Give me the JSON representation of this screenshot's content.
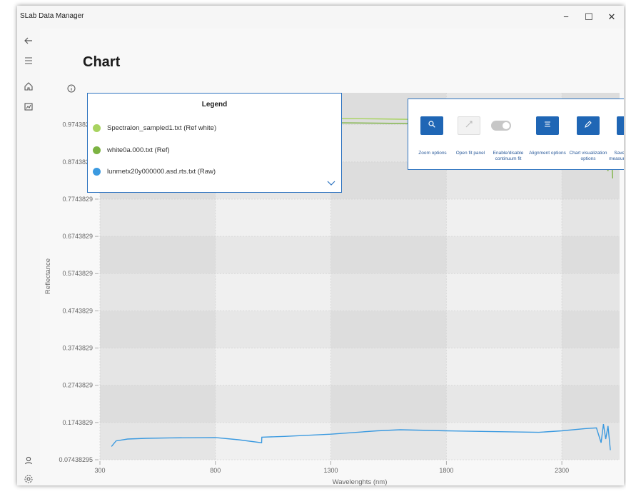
{
  "window": {
    "title": "SLab Data Manager",
    "controls": {
      "minimize": "−",
      "maximize": "☐",
      "close": "✕"
    }
  },
  "rail": {
    "top_icons": [
      "back-arrow-icon",
      "hamburger-menu-icon",
      "home-icon",
      "chart-icon"
    ],
    "bottom_icons": [
      "user-icon",
      "settings-gear-icon"
    ]
  },
  "page": {
    "title": "Chart"
  },
  "legend": {
    "title": "Legend",
    "items": [
      {
        "label": "Spectralon_sampled1.txt (Ref white)",
        "color": "#a8d360"
      },
      {
        "label": "white0a.000.txt (Ref)",
        "color": "#7cb342"
      },
      {
        "label": "lunmetx20y000000.asd.rts.txt (Raw)",
        "color": "#3b9ae0"
      }
    ]
  },
  "toolbar": {
    "zoom_label": "Zoom options",
    "open_fit_label": "Open fit panel",
    "continuum_label": "Enable/disable continuum fit",
    "alignment_label": "Alignment options",
    "chart_vis_label": "Chart visualization options",
    "save_label": "Save sample/ measurement/ info"
  },
  "chart_data": {
    "type": "line",
    "xlabel": "Wavelenghts (nm)",
    "ylabel": "Reflectance",
    "xlim": [
      300,
      2550
    ],
    "ylim": [
      0.07438295,
      1.06
    ],
    "x_ticks": [
      "300",
      "800",
      "1300",
      "1800",
      "2300"
    ],
    "y_ticks": [
      "0.07438295",
      "0.1743829",
      "0.2743829",
      "0.3743829",
      "0.4743829",
      "0.5743829",
      "0.6743829",
      "0.7743829",
      "0.8743829",
      "0.9743829"
    ],
    "grid": true,
    "series": [
      {
        "name": "Spectralon_sampled1.txt (Ref white)",
        "color": "#a8d360",
        "x": [
          300,
          350,
          400,
          500,
          700,
          900,
          1100,
          1300,
          1500,
          1700,
          1800,
          1900,
          2000,
          2100,
          2200,
          2250,
          2300,
          2400,
          2450,
          2480,
          2500
        ],
        "y": [
          0.985,
          0.995,
          0.998,
          0.998,
          0.996,
          0.994,
          0.992,
          0.991,
          0.99,
          0.988,
          0.987,
          0.983,
          0.978,
          0.968,
          0.962,
          0.955,
          0.958,
          0.955,
          0.952,
          0.95,
          0.948
        ]
      },
      {
        "name": "white0a.000.txt (Ref)",
        "color": "#7cb342",
        "x": [
          350,
          380,
          450,
          600,
          800,
          1000,
          1200,
          1400,
          1600,
          1800,
          1950,
          2050,
          2100,
          2130,
          2180,
          2220,
          2300,
          2400,
          2450,
          2480,
          2500,
          2510,
          2520
        ],
        "y": [
          0.965,
          0.985,
          0.985,
          0.985,
          0.984,
          0.982,
          0.98,
          0.979,
          0.978,
          0.976,
          0.97,
          0.955,
          0.935,
          0.93,
          0.95,
          0.95,
          0.93,
          0.92,
          0.905,
          0.9,
          0.85,
          0.96,
          0.83
        ]
      },
      {
        "name": "lunmetx20y000000.asd.rts.txt (Raw)",
        "color": "#3b9ae0",
        "x": [
          350,
          370,
          420,
          500,
          600,
          800,
          900,
          1000,
          1001,
          1100,
          1300,
          1500,
          1600,
          1800,
          2000,
          2200,
          2300,
          2400,
          2450,
          2470,
          2480,
          2490,
          2500,
          2510
        ],
        "y": [
          0.11,
          0.125,
          0.13,
          0.132,
          0.133,
          0.134,
          0.128,
          0.12,
          0.135,
          0.137,
          0.143,
          0.152,
          0.155,
          0.152,
          0.15,
          0.148,
          0.152,
          0.158,
          0.16,
          0.12,
          0.17,
          0.13,
          0.165,
          0.1
        ]
      }
    ]
  }
}
